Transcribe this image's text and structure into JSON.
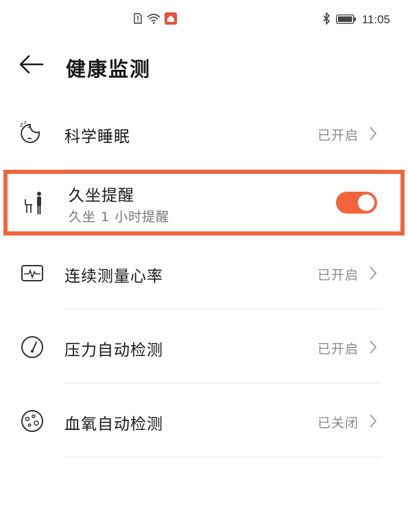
{
  "status_bar": {
    "time": "11:05"
  },
  "header": {
    "title": "健康监测"
  },
  "items": [
    {
      "label": "科学睡眠",
      "status": "已开启"
    },
    {
      "label": "久坐提醒",
      "sublabel": "久坐 1 小时提醒",
      "toggle_on": true
    },
    {
      "label": "连续测量心率",
      "status": "已开启"
    },
    {
      "label": "压力自动检测",
      "status": "已开启"
    },
    {
      "label": "血氧自动检测",
      "status": "已关闭"
    }
  ],
  "colors": {
    "accent": "#f0663a",
    "text_primary": "#1a1a1a",
    "text_secondary": "#8a8a8a"
  }
}
